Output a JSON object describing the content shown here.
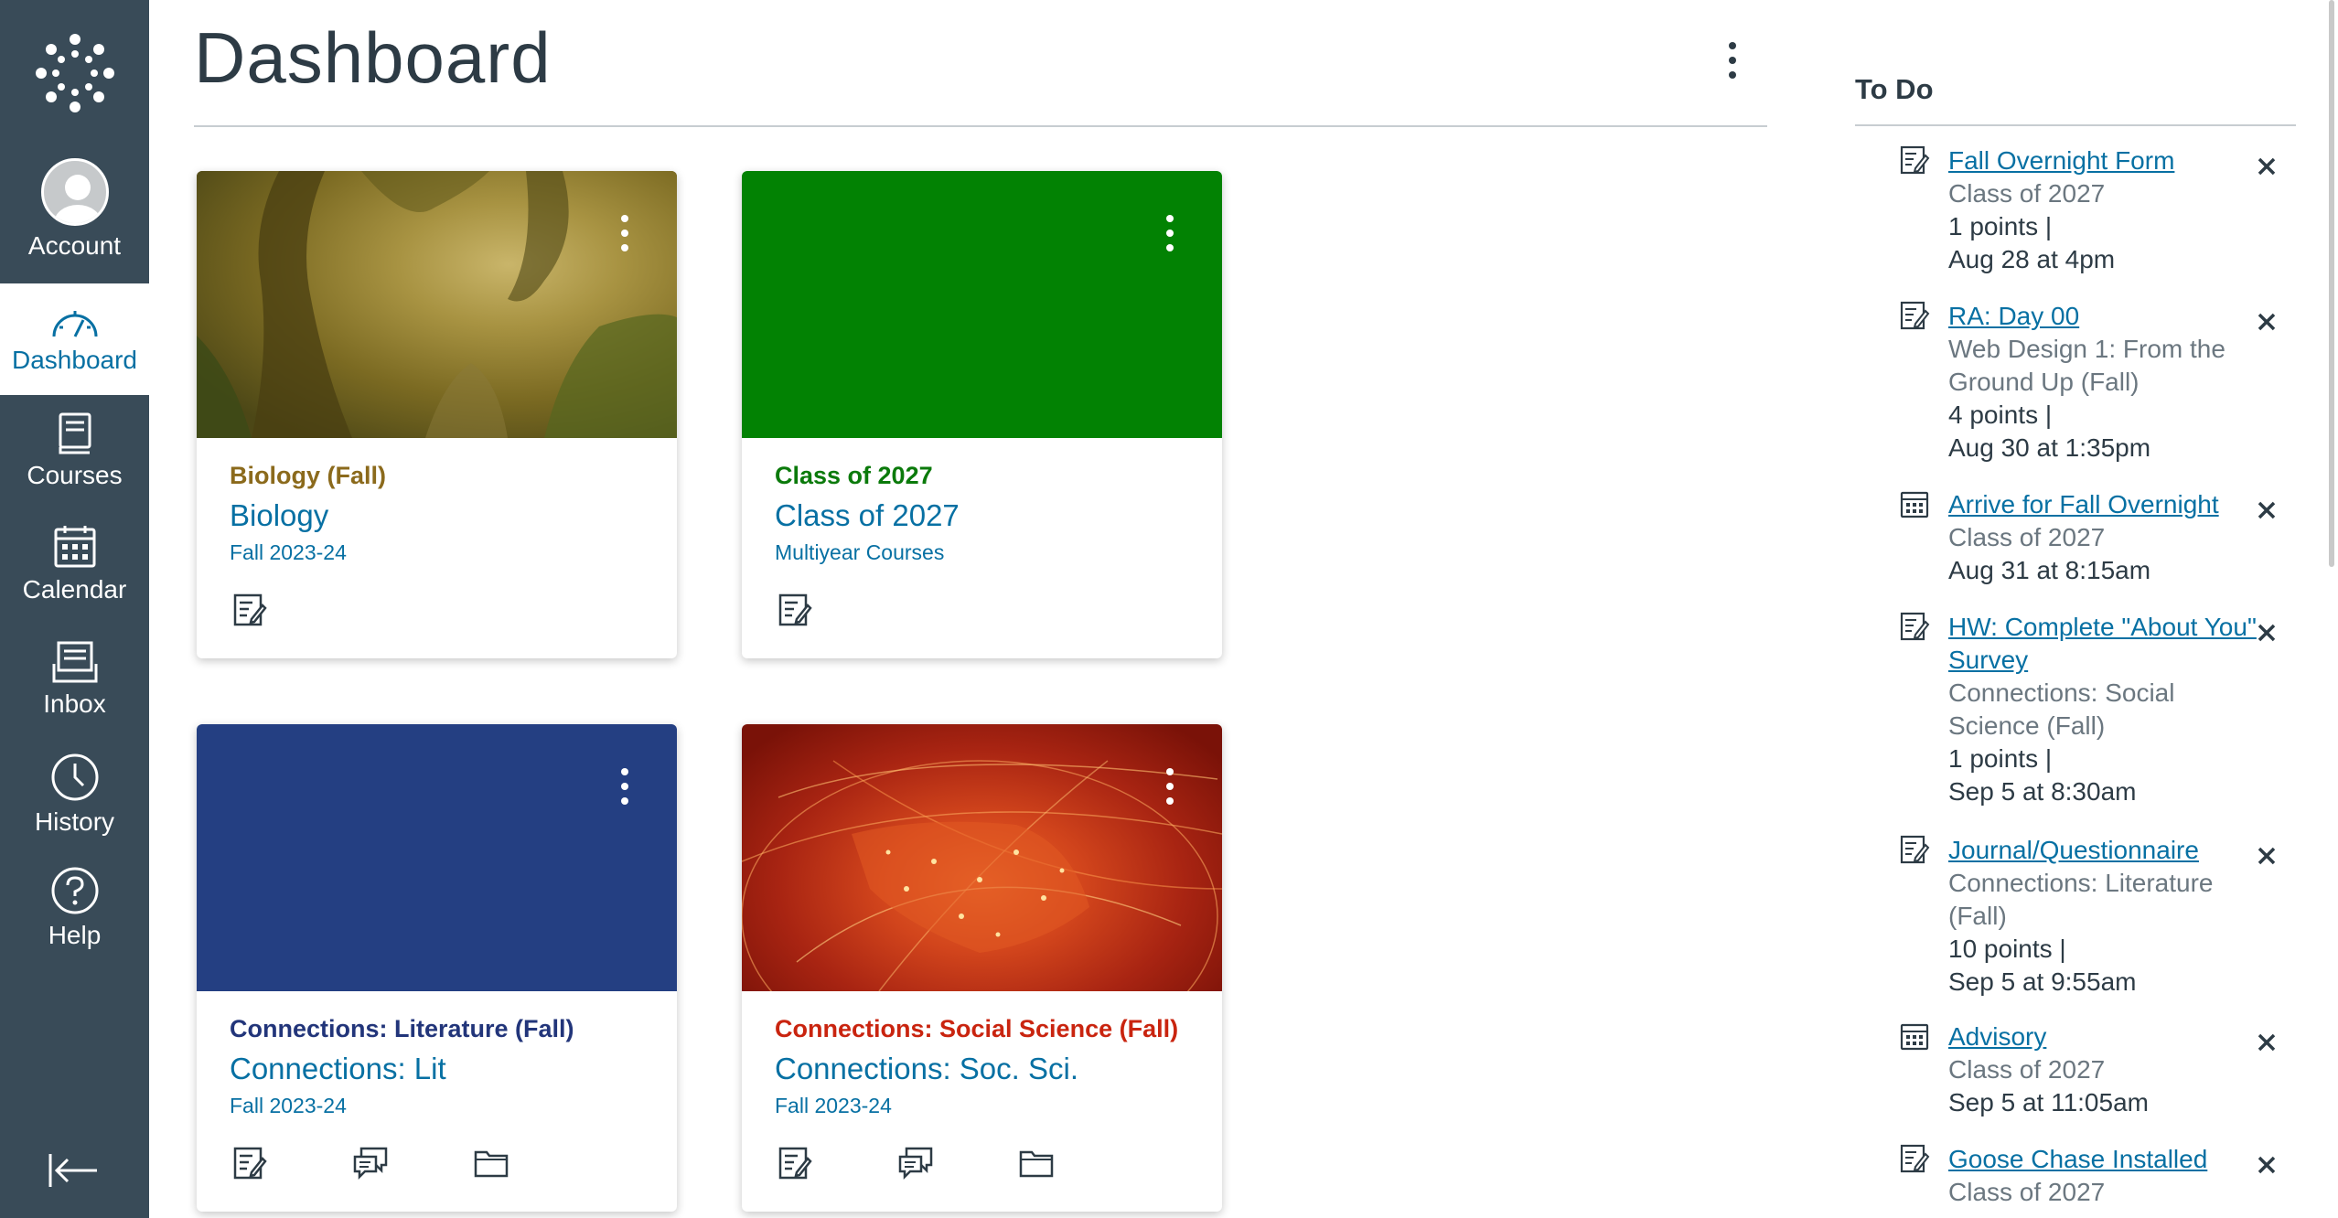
{
  "nav": {
    "items": [
      {
        "label": "Account",
        "icon": "avatar"
      },
      {
        "label": "Dashboard",
        "icon": "dashboard-icon"
      },
      {
        "label": "Courses",
        "icon": "courses-icon"
      },
      {
        "label": "Calendar",
        "icon": "calendar-icon"
      },
      {
        "label": "Inbox",
        "icon": "inbox-icon"
      },
      {
        "label": "History",
        "icon": "history-icon"
      },
      {
        "label": "Help",
        "icon": "help-icon"
      }
    ],
    "active": "Dashboard",
    "bg_color": "#394b58",
    "active_color": "#0770a3"
  },
  "page": {
    "title": "Dashboard"
  },
  "cards": [
    {
      "subtitle": "Biology (Fall)",
      "title": "Biology",
      "term": "Fall 2023-24",
      "color": "#8b6a1c",
      "hero": "forest-image",
      "actions": [
        "assignments-icon"
      ]
    },
    {
      "subtitle": "Class of 2027",
      "title": "Class of 2027",
      "term": "Multiyear Courses",
      "color": "#0b7a0b",
      "hero_color": "#028203",
      "actions": [
        "assignments-icon"
      ]
    },
    {
      "subtitle": "Connections: Literature (Fall)",
      "title": "Connections: Lit",
      "term": "Fall 2023-24",
      "color": "#22357a",
      "hero_color": "#243f82",
      "actions": [
        "assignments-icon",
        "discussions-icon",
        "files-icon"
      ]
    },
    {
      "subtitle": "Connections: Social Science (Fall)",
      "title": "Connections: Soc. Sci.",
      "term": "Fall 2023-24",
      "color": "#c9240f",
      "hero": "globe-network-image",
      "actions": [
        "assignments-icon",
        "discussions-icon",
        "files-icon"
      ]
    }
  ],
  "todo": {
    "header": "To Do",
    "items": [
      {
        "icon": "assignment-icon",
        "title": "Fall Overnight Form",
        "course": "Class of 2027",
        "points": "1 points  |",
        "due": "Aug 28 at 4pm"
      },
      {
        "icon": "assignment-icon",
        "title": "RA: Day 00",
        "course": "Web Design 1: From the Ground Up (Fall)",
        "points": "4 points  |",
        "due": "Aug 30 at 1:35pm"
      },
      {
        "icon": "calendar-event-icon",
        "title": "Arrive for Fall Overnight",
        "course": "Class of 2027",
        "points": "",
        "due": "Aug 31 at 8:15am"
      },
      {
        "icon": "assignment-icon",
        "title": "HW: Complete \"About You\" Survey",
        "course": "Connections: Social Science (Fall)",
        "points": "1 points  |",
        "due": "Sep 5 at 8:30am"
      },
      {
        "icon": "assignment-icon",
        "title": "Journal/Questionnaire",
        "course": "Connections: Literature (Fall)",
        "points": "10 points  |",
        "due": "Sep 5 at 9:55am"
      },
      {
        "icon": "calendar-event-icon",
        "title": "Advisory",
        "course": "Class of 2027",
        "points": "",
        "due": "Sep 5 at 11:05am"
      },
      {
        "icon": "assignment-icon",
        "title": "Goose Chase Installed",
        "course": "Class of 2027",
        "points": "",
        "due": ""
      }
    ]
  }
}
